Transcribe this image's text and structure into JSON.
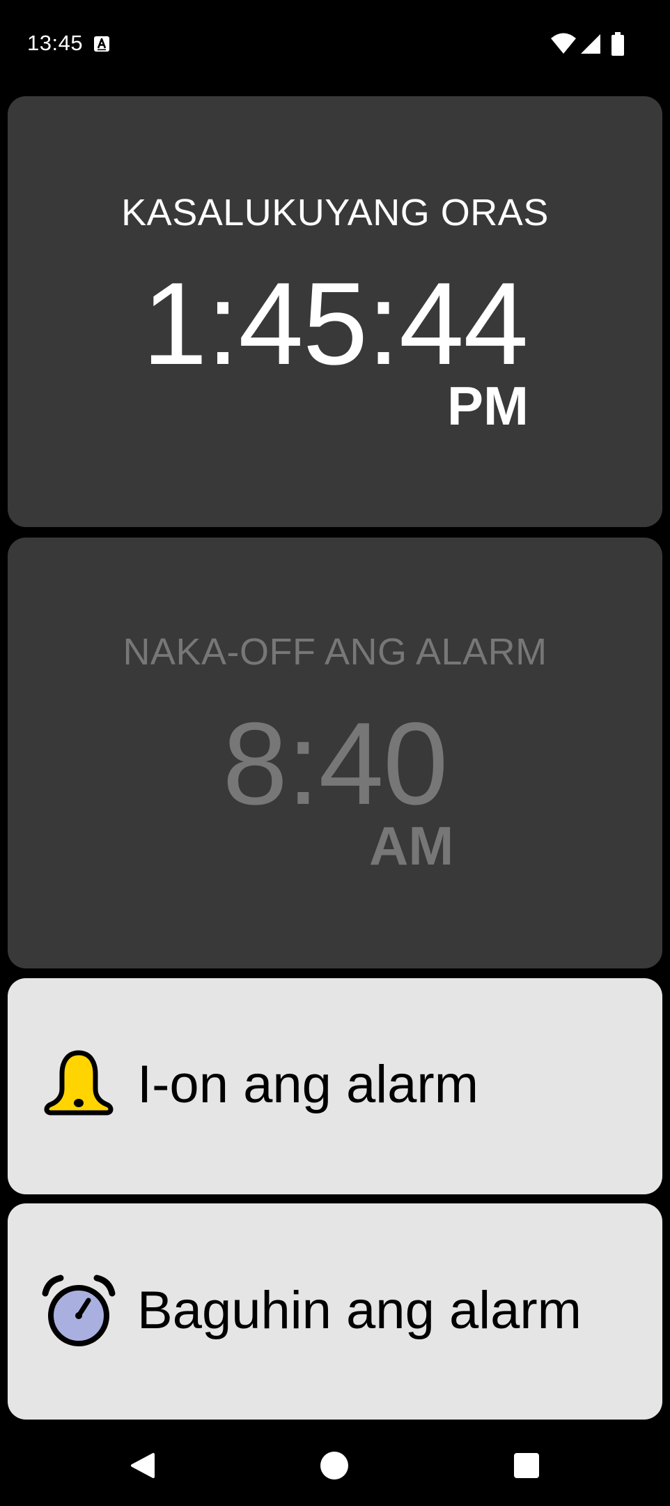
{
  "status_bar": {
    "time": "13:45",
    "icons": [
      "keyboard-a-icon",
      "wifi-icon",
      "cellular-signal-icon",
      "battery-icon"
    ]
  },
  "current_time_card": {
    "label": "KASALUKUYANG ORAS",
    "time": "1:45:44",
    "ampm": "PM"
  },
  "alarm_card": {
    "label": "NAKA-OFF ANG ALARM",
    "time": "8:40",
    "ampm": "AM"
  },
  "actions": {
    "enable_alarm": {
      "label": "I-on ang alarm",
      "icon": "bell-icon",
      "icon_color": "#ffd400"
    },
    "change_alarm": {
      "label": "Baguhin ang alarm",
      "icon": "alarm-clock-icon",
      "icon_color": "#a9b0e0"
    }
  },
  "nav_bar": {
    "icons": [
      "back-icon",
      "home-icon",
      "recents-icon"
    ]
  },
  "colors": {
    "background": "#000000",
    "card_dark": "#393939",
    "card_light": "#e5e5e5",
    "text_primary": "#ffffff",
    "text_muted": "#777777"
  }
}
